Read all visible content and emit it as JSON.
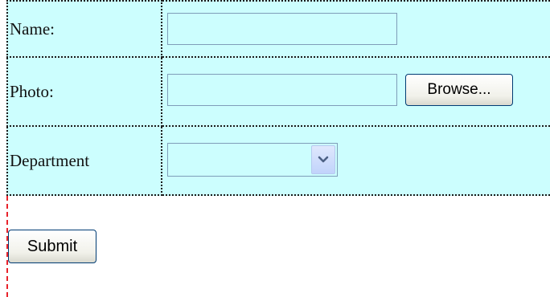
{
  "form": {
    "fields": {
      "name": {
        "label": "Name:",
        "value": ""
      },
      "photo": {
        "label": "Photo:",
        "value": "",
        "browse_label": "Browse..."
      },
      "department": {
        "label": "Department",
        "selected": "",
        "arrow_icon": "chevron-down-icon"
      }
    },
    "submit_label": "Submit"
  },
  "colors": {
    "field_background": "#ccfefe",
    "guide_line": "#e8232b",
    "input_border": "#7f9db9",
    "button_border": "#003c74"
  }
}
